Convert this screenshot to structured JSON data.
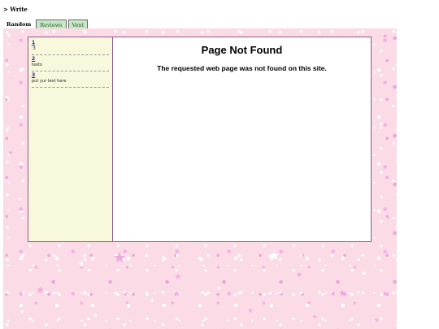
{
  "header": {
    "title": "> Write"
  },
  "tabs": [
    {
      "label": "Random",
      "active": true
    },
    {
      "label": "Reviews",
      "active": false
    },
    {
      "label": "Vent",
      "active": false
    }
  ],
  "sidebar": {
    "posts": [
      {
        "link": "1",
        "text": ":3"
      },
      {
        "link": "2",
        "text": "texto"
      },
      {
        "link": "3",
        "text": "put yur text here"
      }
    ]
  },
  "main": {
    "title": "Page Not Found",
    "message": "The requested web page was not found on this site."
  },
  "colors": {
    "background_pink": "#fadbe6",
    "sidebar_bg": "#f8f8dc",
    "tab_inactive_bg": "#c6e6c6",
    "frame_border": "#8c5a8c",
    "link_blue": "#2222aa"
  },
  "icons": [
    "star-decoration"
  ]
}
